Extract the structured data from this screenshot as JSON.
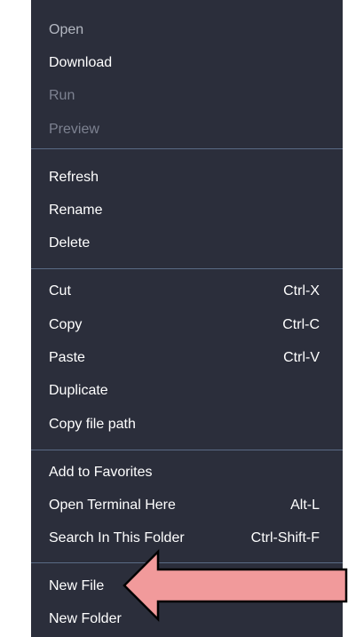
{
  "menu": {
    "items": [
      {
        "label": "Open",
        "shortcut": "",
        "state": "dim"
      },
      {
        "label": "Download",
        "shortcut": "",
        "state": "enabled"
      },
      {
        "label": "Run",
        "shortcut": "",
        "state": "disabled"
      },
      {
        "label": "Preview",
        "shortcut": "",
        "state": "disabled"
      },
      {
        "label": "Refresh",
        "shortcut": "",
        "state": "enabled"
      },
      {
        "label": "Rename",
        "shortcut": "",
        "state": "enabled"
      },
      {
        "label": "Delete",
        "shortcut": "",
        "state": "enabled"
      },
      {
        "label": "Cut",
        "shortcut": "Ctrl-X",
        "state": "enabled"
      },
      {
        "label": "Copy",
        "shortcut": "Ctrl-C",
        "state": "enabled"
      },
      {
        "label": "Paste",
        "shortcut": "Ctrl-V",
        "state": "enabled"
      },
      {
        "label": "Duplicate",
        "shortcut": "",
        "state": "enabled"
      },
      {
        "label": "Copy file path",
        "shortcut": "",
        "state": "enabled"
      },
      {
        "label": "Add to Favorites",
        "shortcut": "",
        "state": "enabled"
      },
      {
        "label": "Open Terminal Here",
        "shortcut": "Alt-L",
        "state": "enabled"
      },
      {
        "label": "Search In This Folder",
        "shortcut": "Ctrl-Shift-F",
        "state": "enabled"
      },
      {
        "label": "New File",
        "shortcut": "",
        "state": "enabled"
      },
      {
        "label": "New Folder",
        "shortcut": "",
        "state": "enabled"
      }
    ]
  },
  "colors": {
    "menu_background": "#2b2e3b",
    "separator": "#5a6b85",
    "arrow_fill": "#f19a9b",
    "arrow_stroke": "#000000"
  },
  "annotation": {
    "icon": "pointing-arrow-icon",
    "points_to": "New File"
  }
}
